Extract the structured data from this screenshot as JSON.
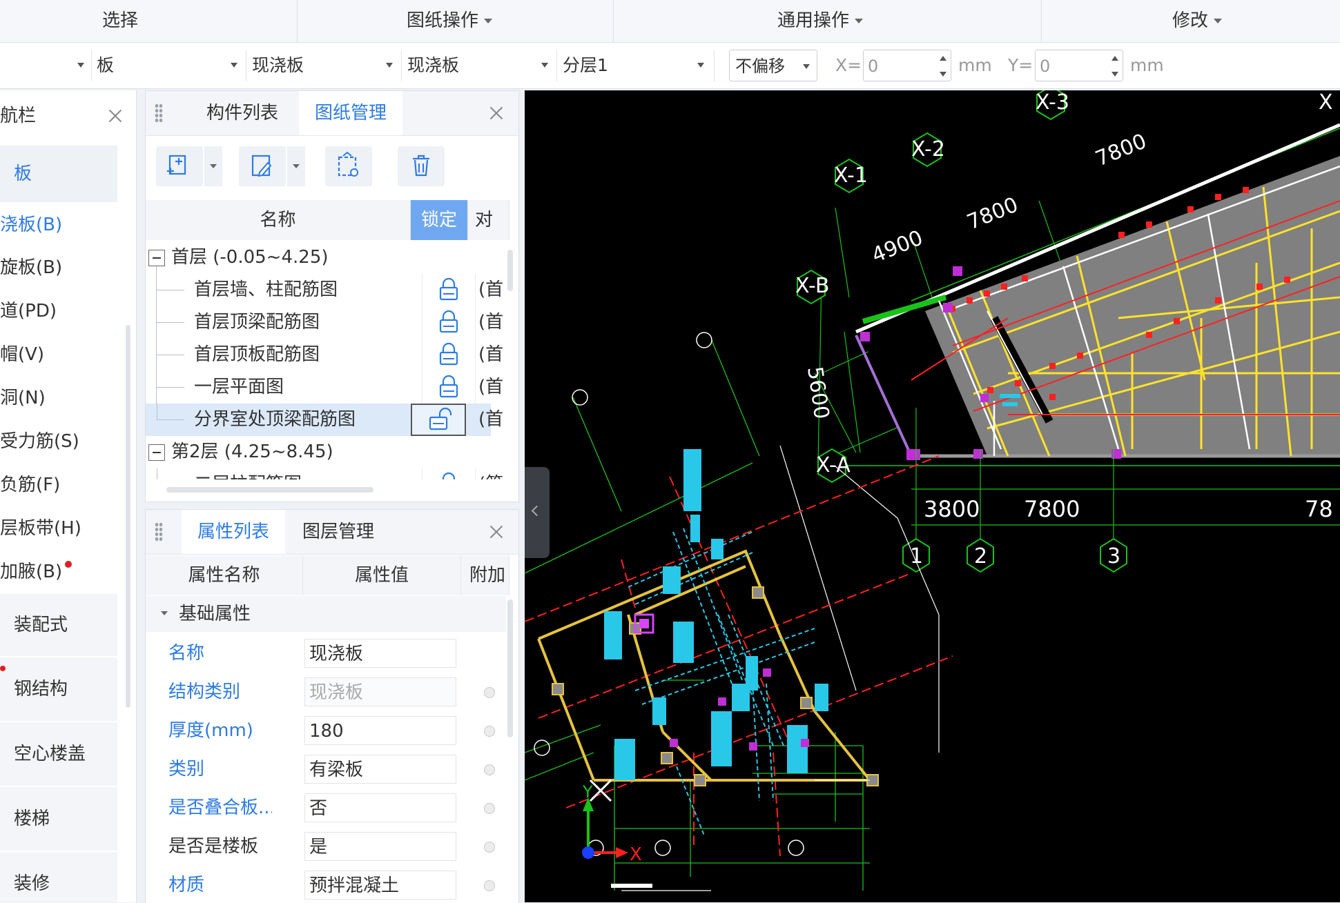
{
  "menu": {
    "select": "选择",
    "drawing_ops": "图纸操作",
    "general_ops": "通用操作",
    "modify": "修改"
  },
  "propbar": {
    "combo1": "",
    "type": "板",
    "subtype": "现浇板",
    "component": "现浇板",
    "layer": "分层1",
    "offset": "不偏移",
    "x_label": "X=",
    "x_value": "0",
    "y_label": "Y=",
    "y_value": "0",
    "unit": "mm"
  },
  "nav": {
    "title": "航栏",
    "category_board": "板",
    "items": [
      "浇板(B)",
      "旋板(B)",
      "道(PD)",
      "帽(V)",
      "洞(N)",
      "受力筋(S)",
      "负筋(F)",
      "层板带(H)",
      "加腋(B)"
    ],
    "categories": [
      "装配式",
      "钢结构",
      "空心楼盖",
      "楼梯",
      "装修"
    ],
    "accent": "#2d7be5",
    "badge_color": "#e02020"
  },
  "drawings": {
    "tab_components": "构件列表",
    "tab_drawings": "图纸管理",
    "col_name": "名称",
    "col_lock": "锁定",
    "col_extra": "对",
    "groups": [
      {
        "label": "首层 (-0.05~4.25)",
        "rows": [
          {
            "name": "首层墙、柱配筋图",
            "extra": "(首"
          },
          {
            "name": "首层顶梁配筋图",
            "extra": "(首"
          },
          {
            "name": "首层顶板配筋图",
            "extra": "(首"
          },
          {
            "name": "一层平面图",
            "extra": "(首"
          },
          {
            "name": "分界室处顶梁配筋图",
            "extra": "(首"
          }
        ]
      },
      {
        "label": "第2层 (4.25~8.45)",
        "rows": [
          {
            "name": "二层柱配筋图",
            "extra": "(第"
          }
        ]
      }
    ]
  },
  "props": {
    "tab_props": "属性列表",
    "tab_layers": "图层管理",
    "col_name": "属性名称",
    "col_value": "属性值",
    "col_extra": "附加",
    "group_basic": "基础属性",
    "rows": [
      {
        "name": "名称",
        "value": "现浇板"
      },
      {
        "name": "结构类别",
        "value": "现浇板"
      },
      {
        "name": "厚度(mm)",
        "value": "180"
      },
      {
        "name": "类别",
        "value": "有梁板"
      },
      {
        "name": "是否叠合板...",
        "value": "否"
      },
      {
        "name": "是否是楼板",
        "value": "是"
      },
      {
        "name": "材质",
        "value": "预拌混凝土"
      }
    ]
  },
  "cad": {
    "axes_top": [
      "X-1",
      "X-2",
      "X-3",
      "X"
    ],
    "axes_left": [
      "X-B",
      "X-A"
    ],
    "dims_top": [
      "4900",
      "7800",
      "7800"
    ],
    "dim_vertical": "5600",
    "dims_bottom": [
      "3800",
      "7800",
      "78"
    ],
    "axes_bottom": [
      "1",
      "2",
      "3"
    ],
    "ucs_x": "X",
    "ucs_y": "Y"
  }
}
